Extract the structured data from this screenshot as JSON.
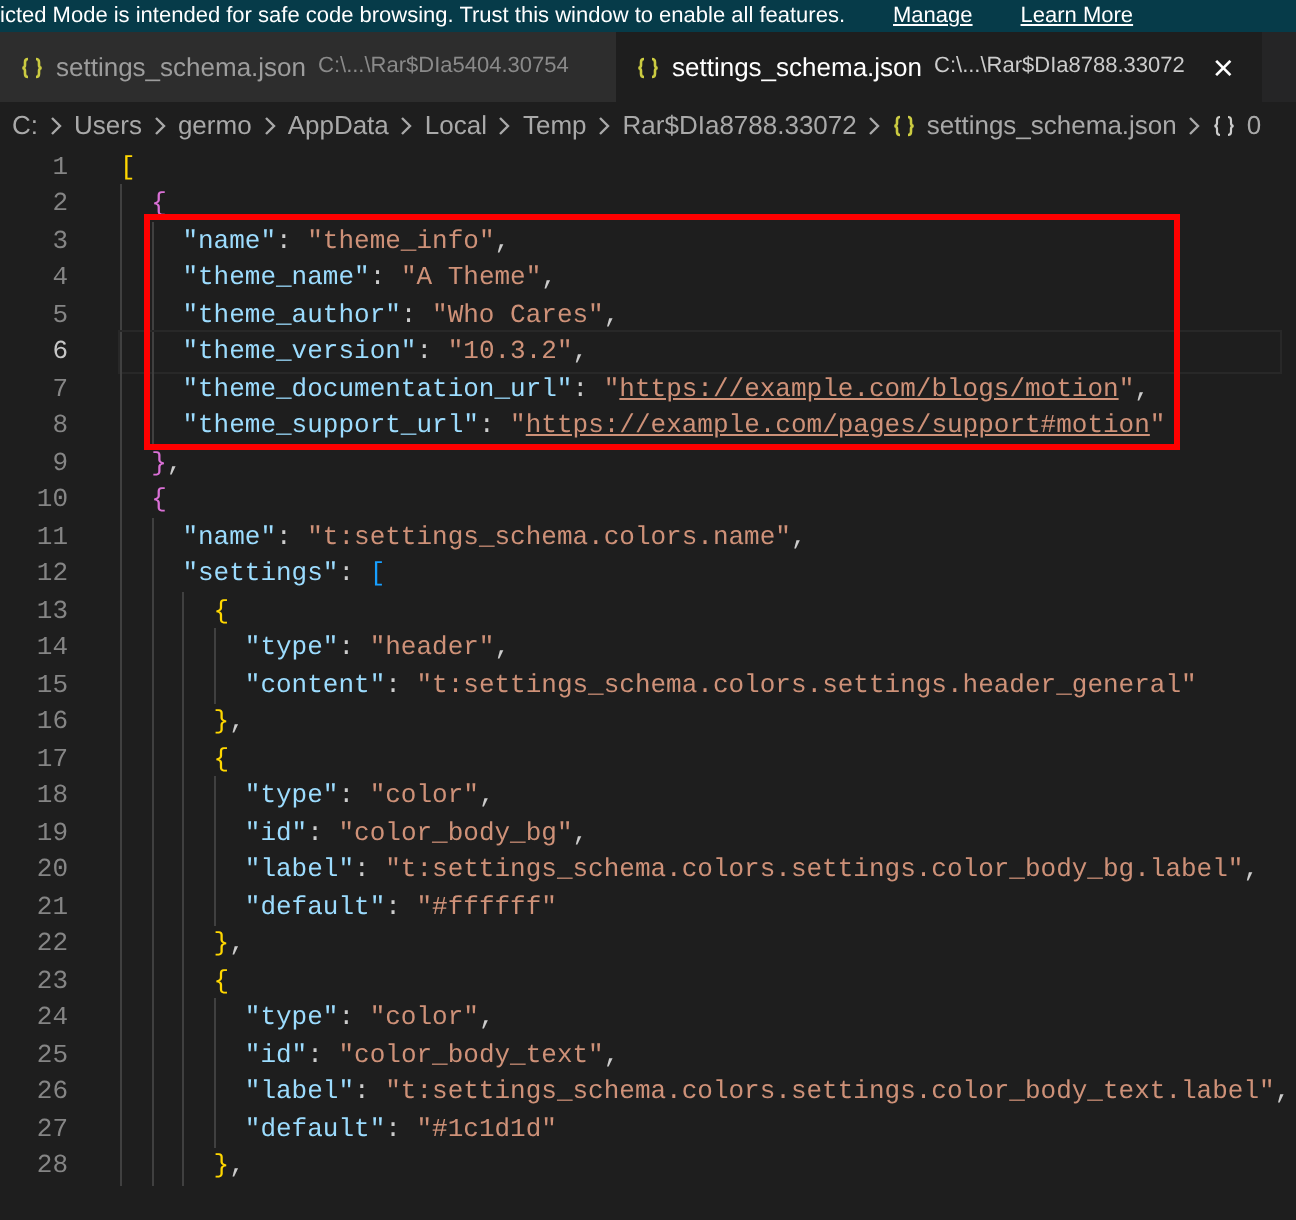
{
  "banner": {
    "message": "icted Mode is intended for safe code browsing. Trust this window to enable all features.",
    "links": [
      "Manage",
      "Learn More"
    ]
  },
  "tabs": [
    {
      "label": "settings_schema.json",
      "path": "C:\\...\\Rar$DIa5404.30754",
      "selected": false
    },
    {
      "label": "settings_schema.json",
      "path": "C:\\...\\Rar$DIa8788.33072",
      "selected": true,
      "close": "×"
    }
  ],
  "breadcrumbs": [
    {
      "kind": "folder",
      "label": "C:"
    },
    {
      "kind": "folder",
      "label": "Users"
    },
    {
      "kind": "folder",
      "label": "germo"
    },
    {
      "kind": "folder",
      "label": "AppData"
    },
    {
      "kind": "folder",
      "label": "Local"
    },
    {
      "kind": "folder",
      "label": "Temp"
    },
    {
      "kind": "folder",
      "label": "Rar$DIa8788.33072"
    },
    {
      "kind": "file",
      "label": "settings_schema.json"
    },
    {
      "kind": "symbol",
      "label": "0"
    }
  ],
  "editor": {
    "lines": [
      {
        "number": "1",
        "current": false,
        "boxed": false,
        "tokens": [
          {
            "kind": "bracket1",
            "text": "["
          }
        ]
      },
      {
        "number": "2",
        "current": false,
        "boxed": false,
        "tokens": [
          {
            "kind": "bracket2",
            "text": "{"
          }
        ]
      },
      {
        "number": "3",
        "current": false,
        "boxed": true,
        "tokens": [
          {
            "kind": "key",
            "text": "\"name\""
          },
          {
            "kind": "punct",
            "text": ":"
          },
          {
            "kind": "string",
            "text": "\"theme_info\""
          },
          {
            "kind": "punct",
            "text": ","
          }
        ]
      },
      {
        "number": "4",
        "current": false,
        "boxed": true,
        "tokens": [
          {
            "kind": "key",
            "text": "\"theme_name\""
          },
          {
            "kind": "punct",
            "text": ":"
          },
          {
            "kind": "string",
            "text": "\"A Theme\""
          },
          {
            "kind": "punct",
            "text": ","
          }
        ]
      },
      {
        "number": "5",
        "current": false,
        "boxed": true,
        "tokens": [
          {
            "kind": "key",
            "text": "\"theme_author\""
          },
          {
            "kind": "punct",
            "text": ":"
          },
          {
            "kind": "string",
            "text": "\"Who Cares\""
          },
          {
            "kind": "punct",
            "text": ","
          }
        ]
      },
      {
        "number": "6",
        "current": true,
        "boxed": true,
        "tokens": [
          {
            "kind": "key",
            "text": "\"theme_version\""
          },
          {
            "kind": "punct",
            "text": ":"
          },
          {
            "kind": "string",
            "text": "\"10.3.2\""
          },
          {
            "kind": "punct",
            "text": ","
          }
        ]
      },
      {
        "number": "7",
        "current": false,
        "boxed": true,
        "tokens": [
          {
            "kind": "key",
            "text": "\"theme_documentation_url\""
          },
          {
            "kind": "punct",
            "text": ":"
          },
          {
            "kind": "string",
            "text": "\""
          },
          {
            "kind": "link",
            "text": "https://example.com/blogs/motion"
          },
          {
            "kind": "string",
            "text": "\""
          },
          {
            "kind": "punct",
            "text": ","
          }
        ]
      },
      {
        "number": "8",
        "current": false,
        "boxed": true,
        "tokens": [
          {
            "kind": "key",
            "text": "\"theme_support_url\""
          },
          {
            "kind": "punct",
            "text": ":"
          },
          {
            "kind": "string",
            "text": "\""
          },
          {
            "kind": "link",
            "text": "https://example.com/pages/support#motion"
          },
          {
            "kind": "string",
            "text": "\""
          }
        ]
      },
      {
        "number": "9",
        "current": false,
        "boxed": false,
        "tokens": [
          {
            "kind": "bracket2",
            "text": "}"
          },
          {
            "kind": "punct",
            "text": ","
          }
        ]
      },
      {
        "number": "10",
        "current": false,
        "boxed": false,
        "tokens": [
          {
            "kind": "bracket2",
            "text": "{"
          }
        ]
      },
      {
        "number": "11",
        "current": false,
        "boxed": false,
        "tokens": [
          {
            "kind": "key",
            "text": "\"name\""
          },
          {
            "kind": "punct",
            "text": ":"
          },
          {
            "kind": "string",
            "text": "\"t:settings_schema.colors.name\""
          },
          {
            "kind": "punct",
            "text": ","
          }
        ]
      },
      {
        "number": "12",
        "current": false,
        "boxed": false,
        "tokens": [
          {
            "kind": "key",
            "text": "\"settings\""
          },
          {
            "kind": "punct",
            "text": ":"
          },
          {
            "kind": "bracket3",
            "text": "["
          }
        ]
      },
      {
        "number": "13",
        "current": false,
        "boxed": false,
        "tokens": [
          {
            "kind": "bracket1",
            "text": "{"
          }
        ]
      },
      {
        "number": "14",
        "current": false,
        "boxed": false,
        "tokens": [
          {
            "kind": "key",
            "text": "\"type\""
          },
          {
            "kind": "punct",
            "text": ":"
          },
          {
            "kind": "string",
            "text": "\"header\""
          },
          {
            "kind": "punct",
            "text": ","
          }
        ]
      },
      {
        "number": "15",
        "current": false,
        "boxed": false,
        "tokens": [
          {
            "kind": "key",
            "text": "\"content\""
          },
          {
            "kind": "punct",
            "text": ":"
          },
          {
            "kind": "string",
            "text": "\"t:settings_schema.colors.settings.header_general\""
          }
        ]
      },
      {
        "number": "16",
        "current": false,
        "boxed": false,
        "tokens": [
          {
            "kind": "bracket1",
            "text": "}"
          },
          {
            "kind": "punct",
            "text": ","
          }
        ]
      },
      {
        "number": "17",
        "current": false,
        "boxed": false,
        "tokens": [
          {
            "kind": "bracket1",
            "text": "{"
          }
        ]
      },
      {
        "number": "18",
        "current": false,
        "boxed": false,
        "tokens": [
          {
            "kind": "key",
            "text": "\"type\""
          },
          {
            "kind": "punct",
            "text": ":"
          },
          {
            "kind": "string",
            "text": "\"color\""
          },
          {
            "kind": "punct",
            "text": ","
          }
        ]
      },
      {
        "number": "19",
        "current": false,
        "boxed": false,
        "tokens": [
          {
            "kind": "key",
            "text": "\"id\""
          },
          {
            "kind": "punct",
            "text": ":"
          },
          {
            "kind": "string",
            "text": "\"color_body_bg\""
          },
          {
            "kind": "punct",
            "text": ","
          }
        ]
      },
      {
        "number": "20",
        "current": false,
        "boxed": false,
        "tokens": [
          {
            "kind": "key",
            "text": "\"label\""
          },
          {
            "kind": "punct",
            "text": ":"
          },
          {
            "kind": "string",
            "text": "\"t:settings_schema.colors.settings.color_body_bg.label\""
          },
          {
            "kind": "punct",
            "text": ","
          }
        ]
      },
      {
        "number": "21",
        "current": false,
        "boxed": false,
        "tokens": [
          {
            "kind": "key",
            "text": "\"default\""
          },
          {
            "kind": "punct",
            "text": ":"
          },
          {
            "kind": "string",
            "text": "\"#ffffff\""
          }
        ]
      },
      {
        "number": "22",
        "current": false,
        "boxed": false,
        "tokens": [
          {
            "kind": "bracket1",
            "text": "}"
          },
          {
            "kind": "punct",
            "text": ","
          }
        ]
      },
      {
        "number": "23",
        "current": false,
        "boxed": false,
        "tokens": [
          {
            "kind": "bracket1",
            "text": "{"
          }
        ]
      },
      {
        "number": "24",
        "current": false,
        "boxed": false,
        "tokens": [
          {
            "kind": "key",
            "text": "\"type\""
          },
          {
            "kind": "punct",
            "text": ":"
          },
          {
            "kind": "string",
            "text": "\"color\""
          },
          {
            "kind": "punct",
            "text": ","
          }
        ]
      },
      {
        "number": "25",
        "current": false,
        "boxed": false,
        "tokens": [
          {
            "kind": "key",
            "text": "\"id\""
          },
          {
            "kind": "punct",
            "text": ":"
          },
          {
            "kind": "string",
            "text": "\"color_body_text\""
          },
          {
            "kind": "punct",
            "text": ","
          }
        ]
      },
      {
        "number": "26",
        "current": false,
        "boxed": false,
        "tokens": [
          {
            "kind": "key",
            "text": "\"label\""
          },
          {
            "kind": "punct",
            "text": ":"
          },
          {
            "kind": "string",
            "text": "\"t:settings_schema.colors.settings.color_body_text.label\""
          },
          {
            "kind": "punct",
            "text": ","
          }
        ]
      },
      {
        "number": "27",
        "current": false,
        "boxed": false,
        "tokens": [
          {
            "kind": "key",
            "text": "\"default\""
          },
          {
            "kind": "punct",
            "text": ":"
          },
          {
            "kind": "string",
            "text": "\"#1c1d1d\""
          }
        ]
      },
      {
        "number": "28",
        "current": false,
        "boxed": false,
        "tokens": [
          {
            "kind": "bracket1",
            "text": "}"
          },
          {
            "kind": "punct",
            "text": ","
          }
        ]
      }
    ]
  }
}
